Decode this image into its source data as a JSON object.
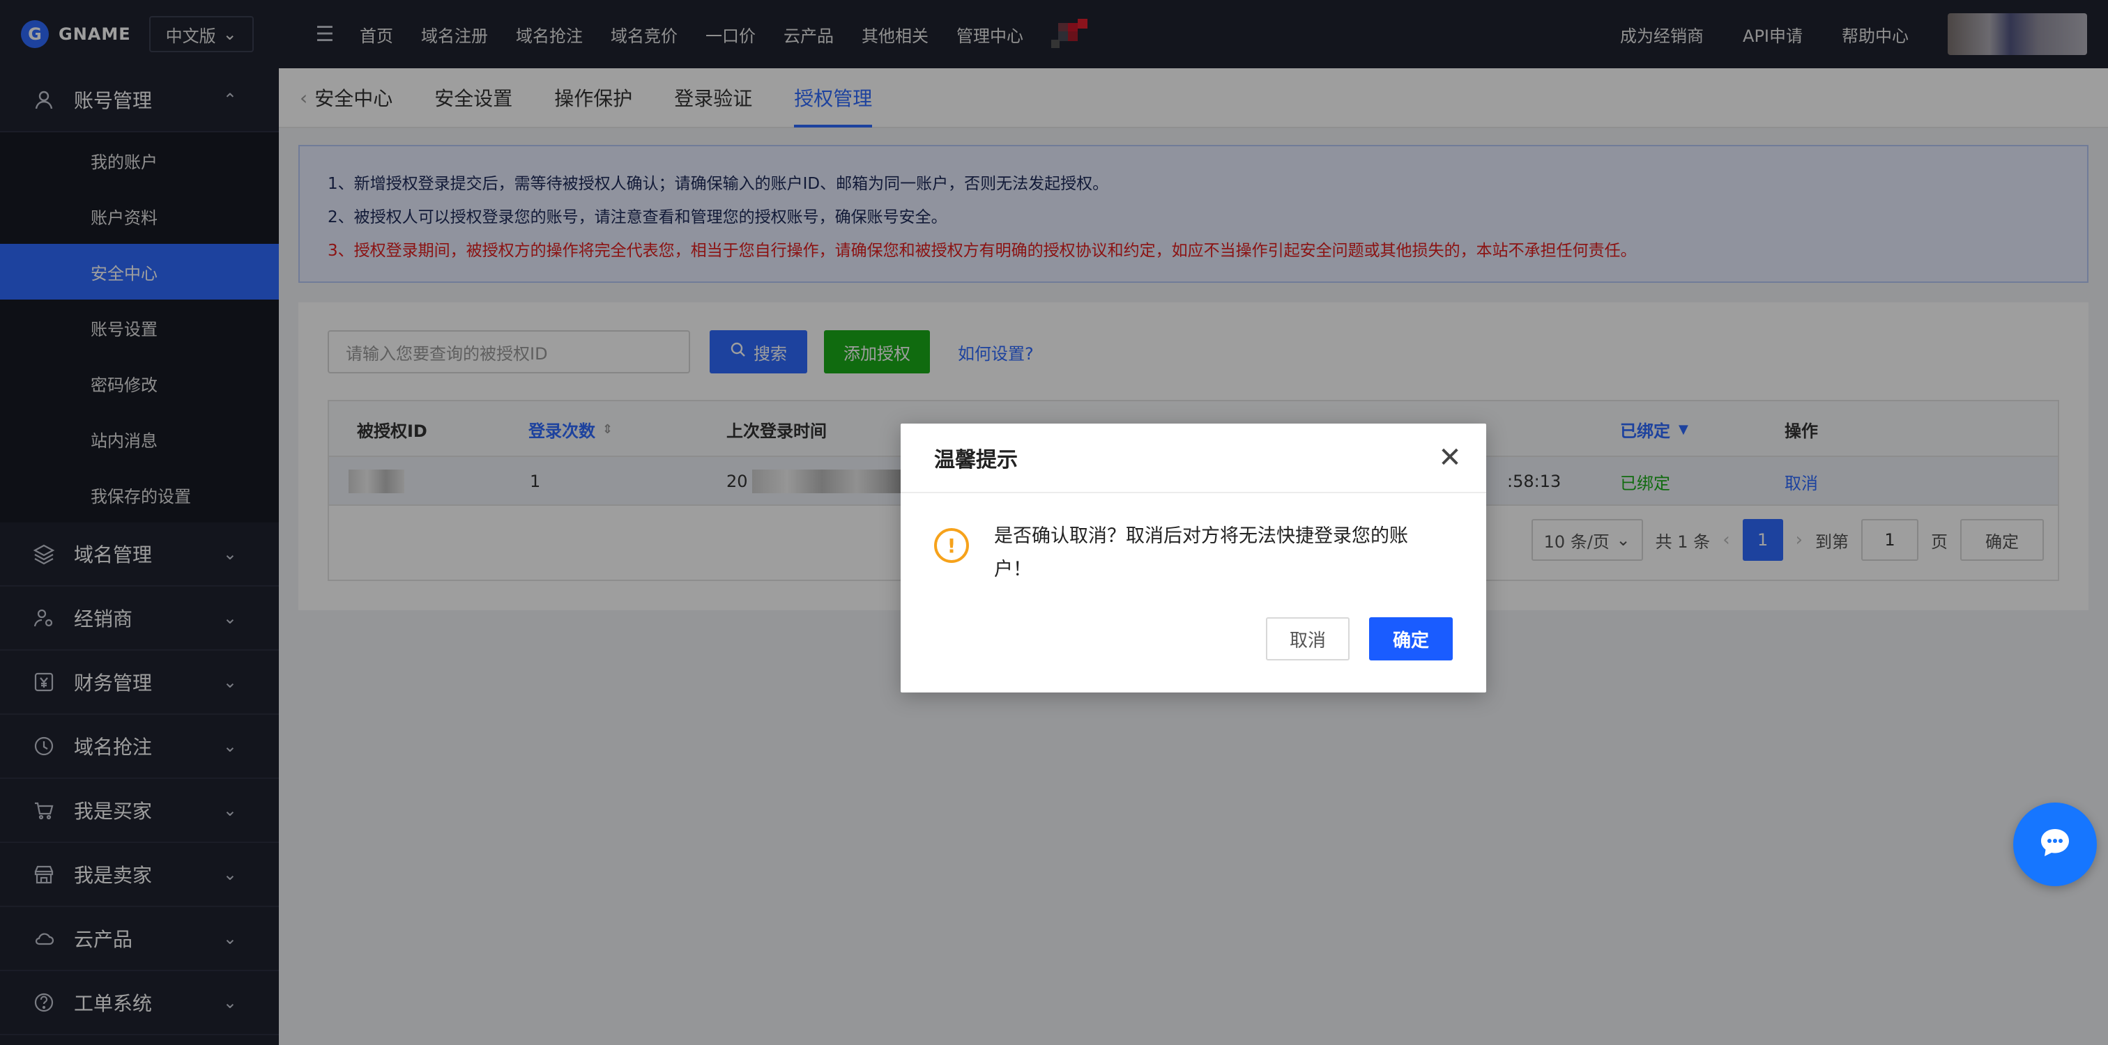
{
  "brand": {
    "logo_letter": "G",
    "name": "GNAME"
  },
  "lang": {
    "label": "中文版"
  },
  "topnav": {
    "items": [
      "首页",
      "域名注册",
      "域名抢注",
      "域名竞价",
      "一口价",
      "云产品",
      "其他相关",
      "管理中心"
    ],
    "right": [
      "成为经销商",
      "API申请",
      "帮助中心"
    ]
  },
  "sidebar": {
    "account_group": "账号管理",
    "account_items": [
      "我的账户",
      "账户资料",
      "安全中心",
      "账号设置",
      "密码修改",
      "站内消息",
      "我保存的设置"
    ],
    "active_item": "安全中心",
    "groups": [
      "域名管理",
      "经销商",
      "财务管理",
      "域名抢注",
      "我是买家",
      "我是卖家",
      "云产品",
      "工单系统"
    ]
  },
  "tabs": {
    "back": "安全中心",
    "items": [
      "安全设置",
      "操作保护",
      "登录验证",
      "授权管理"
    ],
    "active": "授权管理"
  },
  "notice": {
    "line1": "1、新增授权登录提交后，需等待被授权人确认；请确保输入的账户ID、邮箱为同一账户，否则无法发起授权。",
    "line2": "2、被授权人可以授权登录您的账号，请注意查看和管理您的授权账号，确保账号安全。",
    "line3": "3、授权登录期间，被授权方的操作将完全代表您，相当于您自行操作，请确保您和被授权方有明确的授权协议和约定，如应不当操作引起安全问题或其他损失的，本站不承担任何责任。"
  },
  "search": {
    "placeholder": "请输入您要查询的被授权ID",
    "button": "搜索",
    "add_button": "添加授权",
    "help_link": "如何设置?"
  },
  "table": {
    "headers": {
      "id": "被授权ID",
      "login_count": "登录次数",
      "last_login": "上次登录时间",
      "status": "已绑定",
      "action": "操作"
    },
    "row": {
      "login_count": "1",
      "last_login_prefix": "20",
      "time_suffix": ":58:13",
      "status": "已绑定",
      "action": "取消"
    }
  },
  "pager": {
    "page_size": "10 条/页",
    "total": "共 1 条",
    "current": "1",
    "goto_label": "到第",
    "goto_value": "1",
    "page_unit": "页",
    "confirm": "确定"
  },
  "modal": {
    "title": "温馨提示",
    "message": "是否确认取消？取消后对方将无法快捷登录您的账户！",
    "cancel": "取消",
    "ok": "确定"
  },
  "colors": {
    "primary": "#2f6bff",
    "success": "#1aad19",
    "danger": "#e02020",
    "warning": "#f6a21b",
    "dark": "#1f2230"
  }
}
